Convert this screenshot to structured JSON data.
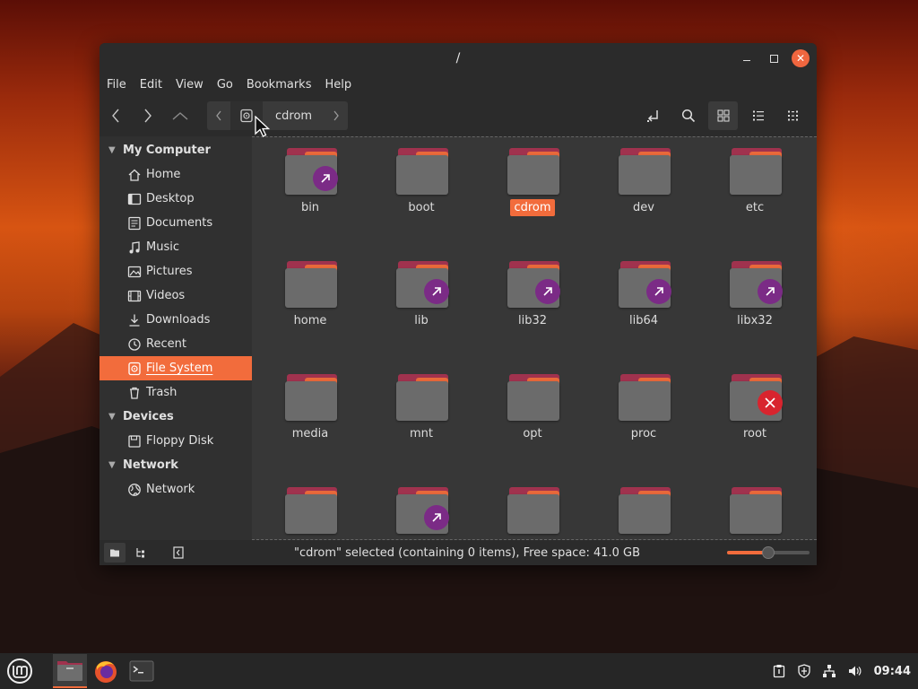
{
  "window": {
    "title": "/",
    "menu": [
      "File",
      "Edit",
      "View",
      "Go",
      "Bookmarks",
      "Help"
    ],
    "path_item": "cdrom"
  },
  "sidebar": {
    "sections": [
      {
        "title": "My Computer",
        "items": [
          {
            "label": "Home",
            "icon": "home-icon"
          },
          {
            "label": "Desktop",
            "icon": "desktop-icon"
          },
          {
            "label": "Documents",
            "icon": "documents-icon"
          },
          {
            "label": "Music",
            "icon": "music-icon"
          },
          {
            "label": "Pictures",
            "icon": "pictures-icon"
          },
          {
            "label": "Videos",
            "icon": "videos-icon"
          },
          {
            "label": "Downloads",
            "icon": "downloads-icon"
          },
          {
            "label": "Recent",
            "icon": "recent-icon"
          },
          {
            "label": "File System",
            "icon": "drive-icon",
            "selected": true
          },
          {
            "label": "Trash",
            "icon": "trash-icon"
          }
        ]
      },
      {
        "title": "Devices",
        "items": [
          {
            "label": "Floppy Disk",
            "icon": "floppy-icon"
          }
        ]
      },
      {
        "title": "Network",
        "items": [
          {
            "label": "Network",
            "icon": "network-icon"
          }
        ]
      }
    ]
  },
  "files": [
    {
      "name": "bin",
      "badge": "link"
    },
    {
      "name": "boot"
    },
    {
      "name": "cdrom",
      "selected": true
    },
    {
      "name": "dev"
    },
    {
      "name": "etc"
    },
    {
      "name": "home"
    },
    {
      "name": "lib",
      "badge": "link"
    },
    {
      "name": "lib32",
      "badge": "link"
    },
    {
      "name": "lib64",
      "badge": "link"
    },
    {
      "name": "libx32",
      "badge": "link"
    },
    {
      "name": "media"
    },
    {
      "name": "mnt"
    },
    {
      "name": "opt"
    },
    {
      "name": "proc"
    },
    {
      "name": "root",
      "badge": "noaccess"
    },
    {
      "name": ""
    },
    {
      "name": "",
      "badge": "link"
    },
    {
      "name": ""
    },
    {
      "name": ""
    },
    {
      "name": ""
    }
  ],
  "status": {
    "text": "\"cdrom\" selected (containing 0 items), Free space: 41.0 GB",
    "zoom_fraction": 0.5
  },
  "taskbar": {
    "clock": "09:44"
  },
  "colors": {
    "accent": "#f26c3c",
    "link_badge": "#7b2b86",
    "noaccess_badge": "#d8242e"
  }
}
